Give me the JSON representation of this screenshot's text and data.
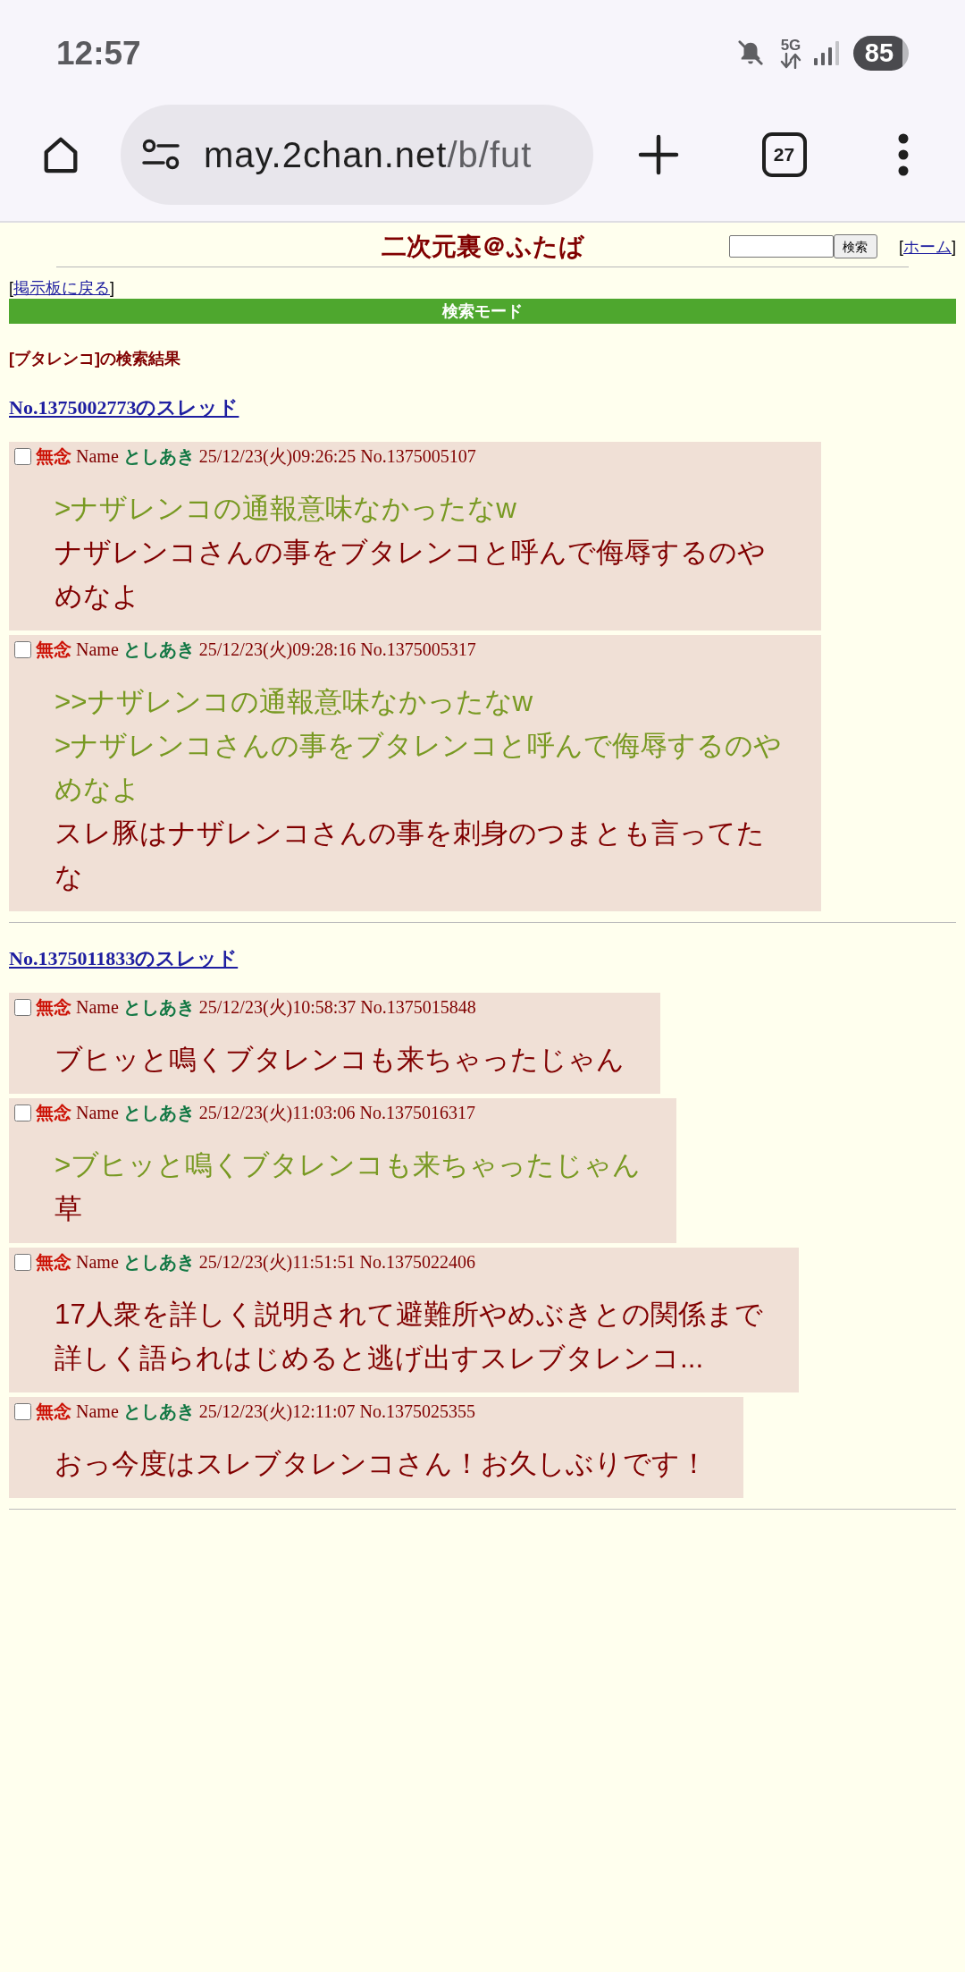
{
  "status_bar": {
    "time": "12:57",
    "network": "5G",
    "battery": "85"
  },
  "browser": {
    "url_host": "may.2chan.net",
    "url_path": "/b/fut",
    "tab_count": "27"
  },
  "header": {
    "title": "二次元裏＠ふたば",
    "search_button": "検索",
    "home": {
      "before": "[",
      "link": "ホーム",
      "after": "]"
    }
  },
  "back": {
    "before": "[",
    "link": "掲示板に戻る",
    "after": "]"
  },
  "mode_bar": "検索モード",
  "result_heading": "[ブタレンコ]の検索結果",
  "threads": [
    {
      "link": "No.1375002773のスレッド",
      "posts": [
        {
          "checked": false,
          "subject": "無念",
          "name_label": "Name",
          "name": "としあき",
          "datetime": "25/12/23(火)09:26:25",
          "number": "No.1375005107",
          "lines": [
            {
              "kind": "quote",
              "text": ">ナザレンコの通報意味なかったなw"
            },
            {
              "kind": "text",
              "text": "ナザレンコさんの事をブタレンコと呼んで侮辱するのやめなよ"
            }
          ]
        },
        {
          "checked": false,
          "subject": "無念",
          "name_label": "Name",
          "name": "としあき",
          "datetime": "25/12/23(火)09:28:16",
          "number": "No.1375005317",
          "lines": [
            {
              "kind": "quote",
              "text": ">>ナザレンコの通報意味なかったなw"
            },
            {
              "kind": "quote",
              "text": ">ナザレンコさんの事をブタレンコと呼んで侮辱するのやめなよ"
            },
            {
              "kind": "text",
              "text": "スレ豚はナザレンコさんの事を刺身のつまとも言ってたな"
            }
          ]
        }
      ]
    },
    {
      "link": "No.1375011833のスレッド",
      "posts": [
        {
          "checked": false,
          "subject": "無念",
          "name_label": "Name",
          "name": "としあき",
          "datetime": "25/12/23(火)10:58:37",
          "number": "No.1375015848",
          "lines": [
            {
              "kind": "text",
              "text": "ブヒッと鳴くブタレンコも来ちゃったじゃん"
            }
          ]
        },
        {
          "checked": false,
          "subject": "無念",
          "name_label": "Name",
          "name": "としあき",
          "datetime": "25/12/23(火)11:03:06",
          "number": "No.1375016317",
          "lines": [
            {
              "kind": "quote",
              "text": ">ブヒッと鳴くブタレンコも来ちゃったじゃん"
            },
            {
              "kind": "text",
              "text": "草"
            }
          ]
        },
        {
          "checked": false,
          "subject": "無念",
          "name_label": "Name",
          "name": "としあき",
          "datetime": "25/12/23(火)11:51:51",
          "number": "No.1375022406",
          "lines": [
            {
              "kind": "text",
              "text": "17人衆を詳しく説明されて避難所やめぶきとの関係まで"
            },
            {
              "kind": "text",
              "text": "詳しく語られはじめると逃げ出すスレブタレンコ..."
            }
          ]
        },
        {
          "checked": false,
          "subject": "無念",
          "name_label": "Name",
          "name": "としあき",
          "datetime": "25/12/23(火)12:11:07",
          "number": "No.1375025355",
          "lines": [
            {
              "kind": "text",
              "text": "おっ今度はスレブタレンコさん！お久しぶりです！"
            }
          ]
        }
      ]
    }
  ]
}
